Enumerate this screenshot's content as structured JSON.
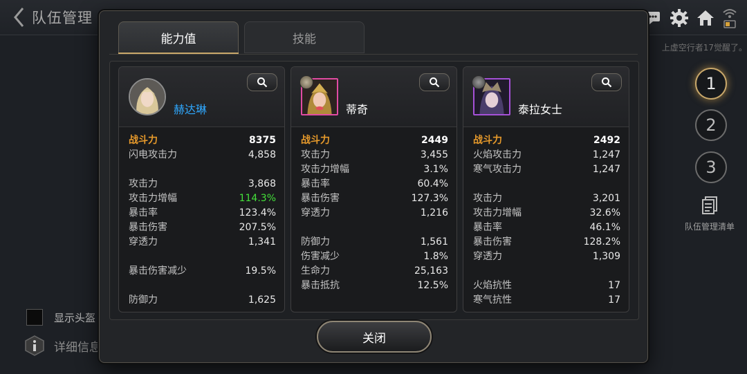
{
  "page": {
    "title": "队伍管理",
    "notice": "上虚空行者17觉醒了。",
    "party_slots": [
      "1",
      "2",
      "3"
    ],
    "list_label": "队伍管理清单",
    "show_helmet_label": "显示头盔",
    "detail_label": "详细信息"
  },
  "modal": {
    "tabs": [
      {
        "label": "能力值",
        "active": true
      },
      {
        "label": "技能",
        "active": false
      }
    ],
    "close_label": "关闭",
    "cards": [
      {
        "name": "赫达琳",
        "name_color": "#2fa8ff",
        "power_label": "战斗力",
        "power": "8375",
        "groups": [
          [
            {
              "k": "闪电攻击力",
              "v": "4,858"
            }
          ],
          [
            {
              "k": "攻击力",
              "v": "3,868"
            },
            {
              "k": "攻击力增幅",
              "v": "114.3%",
              "highlight": true
            },
            {
              "k": "暴击率",
              "v": "123.4%"
            },
            {
              "k": "暴击伤害",
              "v": "207.5%"
            },
            {
              "k": "穿透力",
              "v": "1,341"
            }
          ],
          [
            {
              "k": "暴击伤害减少",
              "v": "19.5%"
            }
          ],
          [
            {
              "k": "防御力",
              "v": "1,625"
            }
          ]
        ]
      },
      {
        "name": "蒂奇",
        "name_color": "#ffffff",
        "power_label": "战斗力",
        "power": "2449",
        "groups": [
          [
            {
              "k": "攻击力",
              "v": "3,455"
            },
            {
              "k": "攻击力增幅",
              "v": "3.1%"
            },
            {
              "k": "暴击率",
              "v": "60.4%"
            },
            {
              "k": "暴击伤害",
              "v": "127.3%"
            },
            {
              "k": "穿透力",
              "v": "1,216"
            }
          ],
          [
            {
              "k": "防御力",
              "v": "1,561"
            },
            {
              "k": "伤害减少",
              "v": "1.8%"
            },
            {
              "k": "生命力",
              "v": "25,163"
            },
            {
              "k": "暴击抵抗",
              "v": "12.5%"
            }
          ]
        ]
      },
      {
        "name": "泰拉女士",
        "name_color": "#ffffff",
        "power_label": "战斗力",
        "power": "2492",
        "groups": [
          [
            {
              "k": "火焰攻击力",
              "v": "1,247"
            },
            {
              "k": "寒气攻击力",
              "v": "1,247"
            }
          ],
          [
            {
              "k": "攻击力",
              "v": "3,201"
            },
            {
              "k": "攻击力增幅",
              "v": "32.6%"
            },
            {
              "k": "暴击率",
              "v": "46.1%"
            },
            {
              "k": "暴击伤害",
              "v": "128.2%"
            },
            {
              "k": "穿透力",
              "v": "1,309"
            }
          ],
          [
            {
              "k": "火焰抗性",
              "v": "17"
            },
            {
              "k": "寒气抗性",
              "v": "17"
            }
          ]
        ]
      }
    ]
  },
  "colors": {
    "accent_gold": "#c9a86b",
    "power_orange": "#e79a2b",
    "highlight_green": "#44e13a",
    "name_blue": "#2fa8ff"
  },
  "icons": [
    "back-icon",
    "chat-icon",
    "gear-icon",
    "home-icon",
    "wifi-icon",
    "battery-icon",
    "search-icon",
    "list-icon",
    "info-icon"
  ]
}
